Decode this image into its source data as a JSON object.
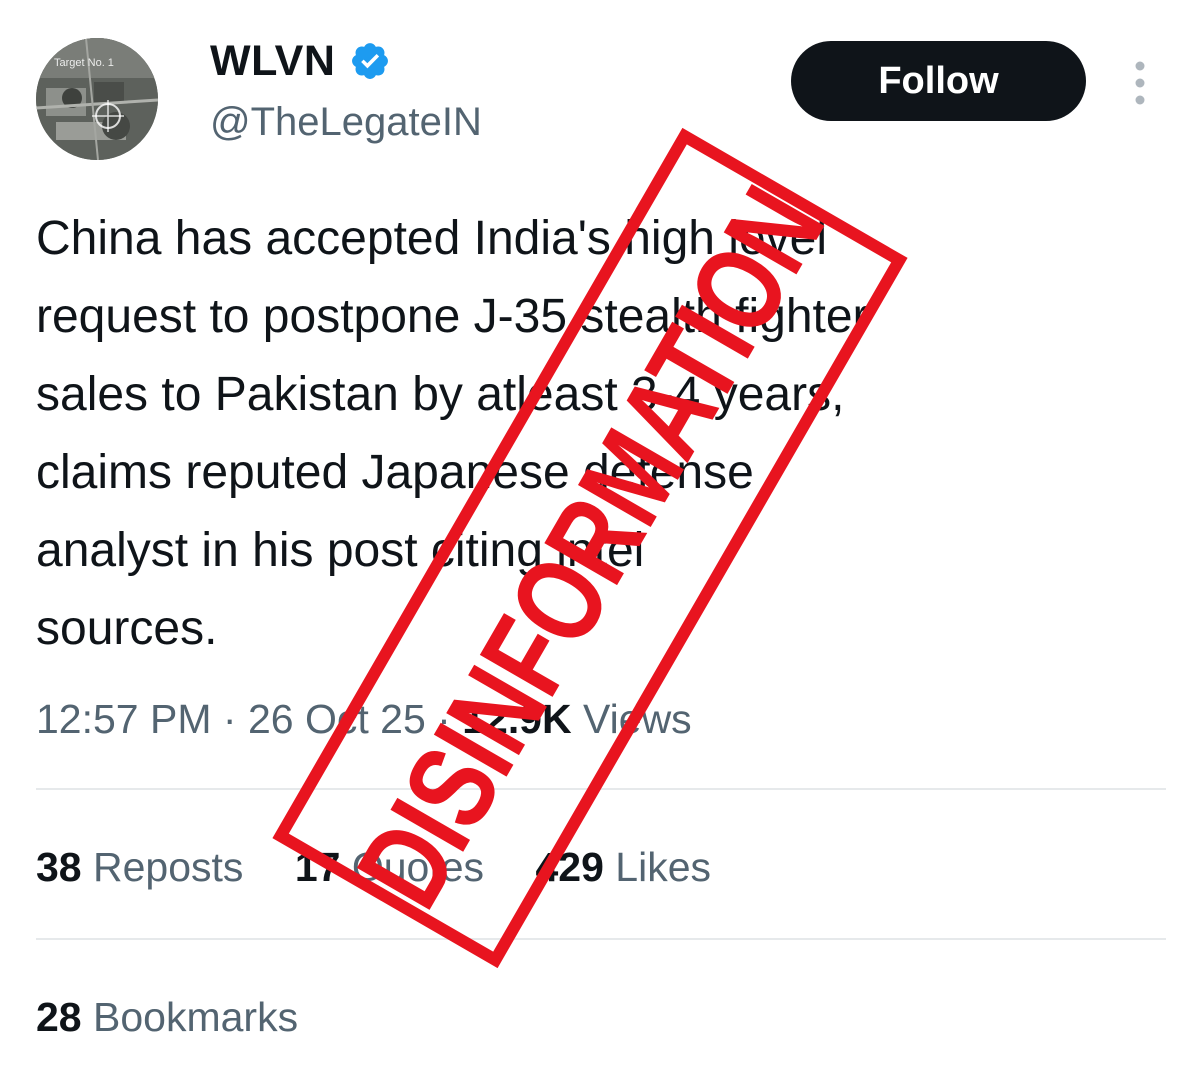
{
  "author": {
    "display_name": "WLVN",
    "handle": "@TheLegateIN",
    "avatar_caption": "Target No. 1",
    "verified_icon": "verified-badge-icon"
  },
  "follow_button": {
    "label": "Follow"
  },
  "more_menu": {
    "icon": "more-vertical-icon"
  },
  "tweet": {
    "text": "China has accepted India's high level\nrequest to postpone J-35 stealth fighter\nsales to Pakistan by atleast 3-4 years,\nclaims reputed Japanese defense\nanalyst in his post citing intel\nsources.",
    "time": "12:57 PM",
    "separator": "·",
    "date": "26 Oct 25",
    "views_count": "12.9K",
    "views_label": "Views"
  },
  "stats": {
    "reposts": {
      "count": "38",
      "label": "Reposts"
    },
    "quotes": {
      "count": "17",
      "label": "Quotes"
    },
    "likes": {
      "count": "429",
      "label": "Likes"
    },
    "bookmarks": {
      "count": "28",
      "label": "Bookmarks"
    }
  },
  "stamp": {
    "text": "DISINFORMATION",
    "color": "#e8141f"
  },
  "colors": {
    "text_primary": "#0f1419",
    "text_secondary": "#536471",
    "verified_blue": "#1d9bf0",
    "divider": "#e6e9eb"
  }
}
